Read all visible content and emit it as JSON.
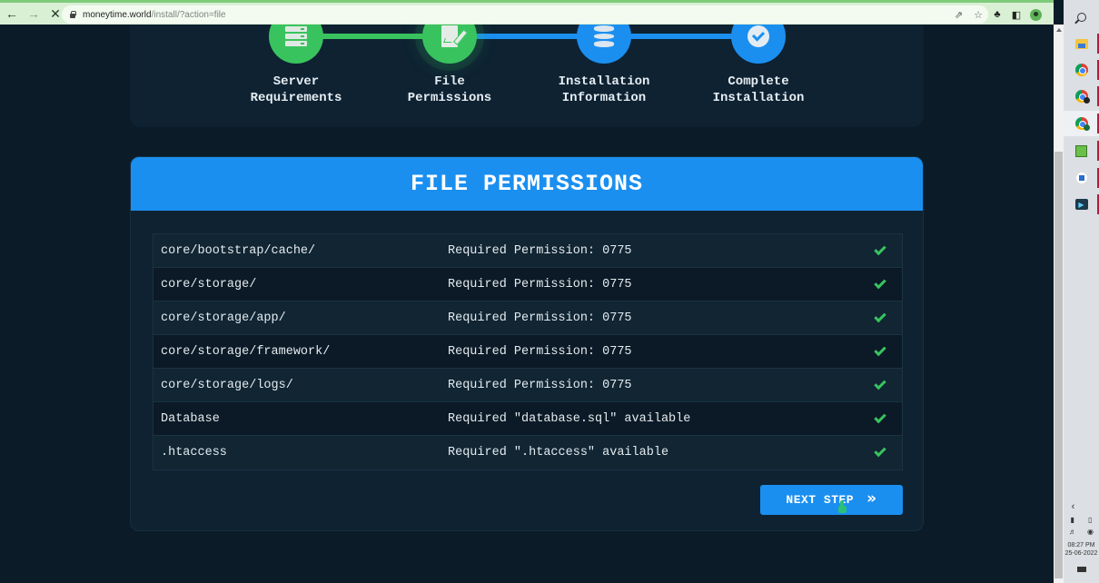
{
  "browser": {
    "url_host": "moneytime.world",
    "url_path": "/install/?action=file",
    "back_icon": "arrow-left-icon",
    "forward_icon": "arrow-right-icon",
    "stop_icon": "close-icon",
    "share_icon": "share-icon",
    "bookmark_icon": "star-icon",
    "extensions_icon": "puzzle-icon",
    "sidepanel_icon": "sidepanel-icon",
    "profile_icon": "avatar-icon",
    "menu_icon": "kebab-menu-icon"
  },
  "taskbar": {
    "apps": [
      {
        "name": "search",
        "icon": "search-icon"
      },
      {
        "name": "file-explorer",
        "icon": "folder-icon"
      },
      {
        "name": "chrome-1",
        "icon": "chrome-icon"
      },
      {
        "name": "chrome-2",
        "icon": "chrome-icon"
      },
      {
        "name": "chrome-3",
        "icon": "chrome-icon"
      },
      {
        "name": "spreadsheet",
        "icon": "spreadsheet-icon"
      },
      {
        "name": "document-app",
        "icon": "document-icon"
      },
      {
        "name": "remote-desktop",
        "icon": "monitor-icon"
      }
    ],
    "time": "08:27 PM",
    "date": "25-06-2022"
  },
  "stepper": {
    "steps": [
      {
        "label_line1": "Server",
        "label_line2": "Requirements",
        "state": "done",
        "icon": "server-icon"
      },
      {
        "label_line1": "File",
        "label_line2": "Permissions",
        "state": "current",
        "icon": "file-edit-icon"
      },
      {
        "label_line1": "Installation",
        "label_line2": "Information",
        "state": "todo",
        "icon": "database-icon"
      },
      {
        "label_line1": "Complete",
        "label_line2": "Installation",
        "state": "todo",
        "icon": "check-circle-icon"
      }
    ]
  },
  "card": {
    "title": "FILE PERMISSIONS",
    "rows": [
      {
        "path": "core/bootstrap/cache/",
        "requirement": "Required Permission: 0775",
        "status": "ok"
      },
      {
        "path": "core/storage/",
        "requirement": "Required Permission: 0775",
        "status": "ok"
      },
      {
        "path": "core/storage/app/",
        "requirement": "Required Permission: 0775",
        "status": "ok"
      },
      {
        "path": "core/storage/framework/",
        "requirement": "Required Permission: 0775",
        "status": "ok"
      },
      {
        "path": "core/storage/logs/",
        "requirement": "Required Permission: 0775",
        "status": "ok"
      },
      {
        "path": "Database",
        "requirement": "Required \"database.sql\" available",
        "status": "ok"
      },
      {
        "path": ".htaccess",
        "requirement": "Required \".htaccess\" available",
        "status": "ok"
      }
    ],
    "next_button_label": "NEXT STEP",
    "next_button_icon": "»"
  },
  "colors": {
    "accent_blue": "#1a8ff0",
    "success_green": "#39c35e",
    "background": "#0b1b28",
    "card": "#0e2232"
  }
}
